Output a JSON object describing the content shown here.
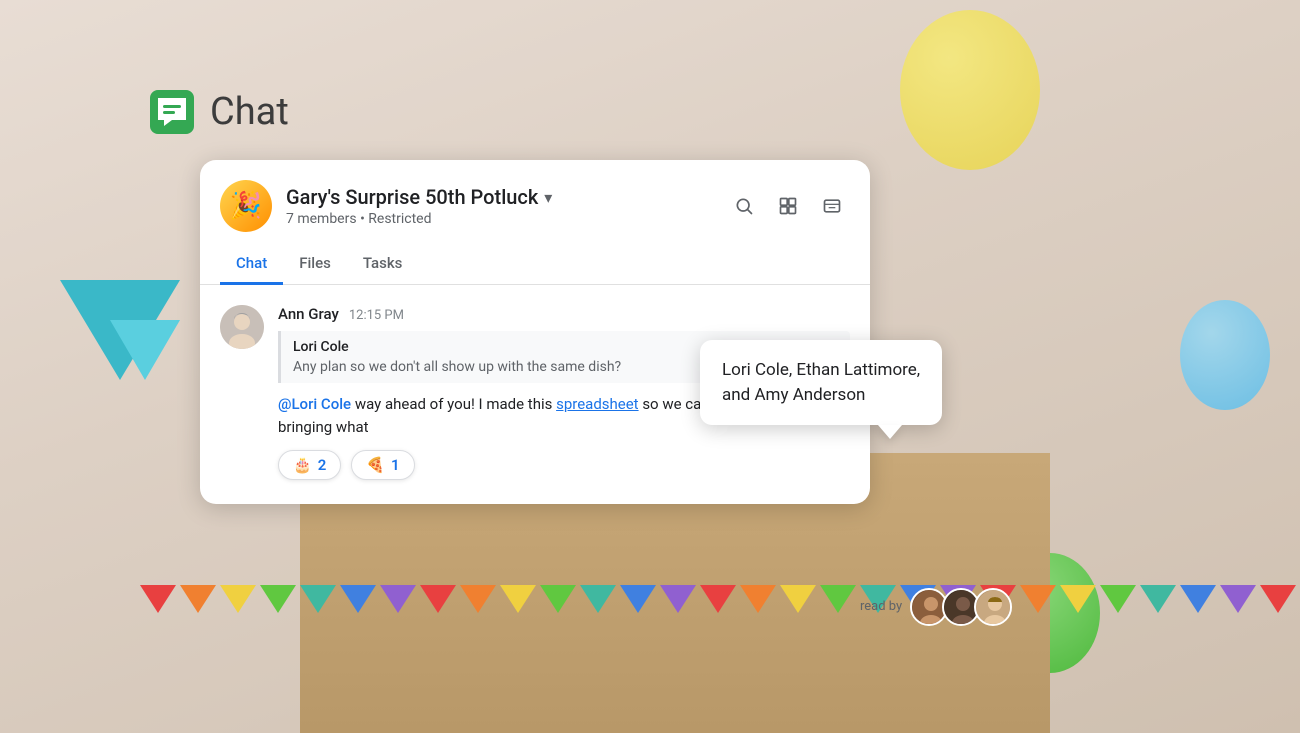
{
  "app": {
    "title": "Chat",
    "icon_emoji": "💬"
  },
  "card": {
    "group_name": "Gary's Surprise 50th Potluck",
    "group_avatar_emoji": "🎉",
    "members_text": "7 members",
    "restricted_text": "Restricted",
    "chevron": "▾",
    "actions": {
      "search_label": "search",
      "layout_label": "layout",
      "chat_label": "chat"
    },
    "tabs": [
      {
        "label": "Chat",
        "active": true
      },
      {
        "label": "Files",
        "active": false
      },
      {
        "label": "Tasks",
        "active": false
      }
    ]
  },
  "message": {
    "sender_name": "Ann Gray",
    "time": "12:15 PM",
    "quoted_sender": "Lori Cole",
    "quoted_text": "Any plan so we don't all show up with the same dish?",
    "mention": "@Lori Cole",
    "text_before_link": " way ahead of you! I made this ",
    "link_text": "spreadsheet",
    "text_after_link": " so we can sign up for who is bringing what"
  },
  "reactions": [
    {
      "emoji": "🎂",
      "count": "2"
    },
    {
      "emoji": "🍕",
      "count": "1"
    }
  ],
  "read_by_popup": {
    "names": "Lori Cole, Ethan Lattimore,\nand Amy Anderson"
  },
  "read_by": {
    "label": "read by"
  }
}
